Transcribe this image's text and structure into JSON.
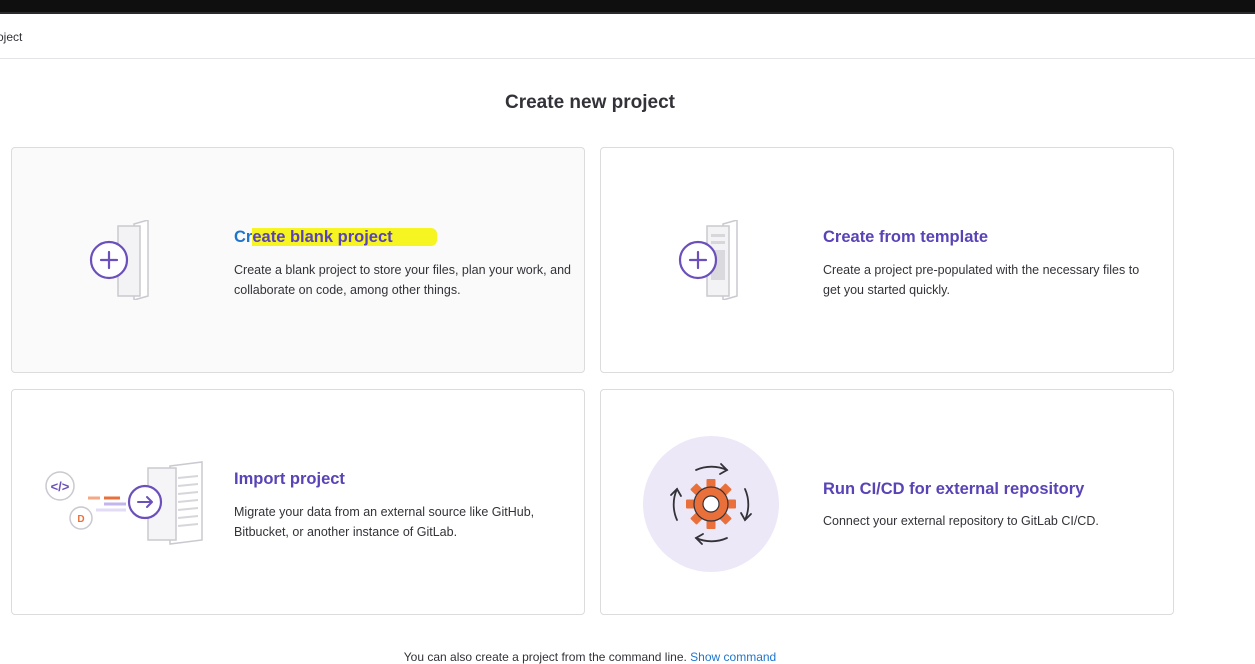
{
  "breadcrumb": {
    "text": "oject"
  },
  "page": {
    "title": "Create new project"
  },
  "cards": {
    "blank": {
      "title_start": "Cr",
      "title_rest": "eate blank project",
      "description": "Create a blank project to store your files, plan your work, and collaborate on code, among other things."
    },
    "template": {
      "title": "Create from template",
      "description": "Create a project pre-populated with the necessary files to get you started quickly."
    },
    "import": {
      "title": "Import project",
      "description": "Migrate your data from an external source like GitHub, Bitbucket, or another instance of GitLab."
    },
    "cicd": {
      "title": "Run CI/CD for external repository",
      "description": "Connect your external repository to GitLab CI/CD."
    }
  },
  "footer": {
    "text": "You can also create a project from the command line.",
    "link": "Show command"
  },
  "icons": {
    "blank": "plus-document-icon",
    "template": "template-document-icon",
    "import": "import-arrow-icon",
    "cicd": "gear-cycle-icon"
  },
  "colors": {
    "accent": "#5943b6",
    "link": "#1f75cb",
    "highlight": "#f6f421",
    "gear_orange": "#e9703b",
    "circle_bg": "#ece8f7"
  }
}
